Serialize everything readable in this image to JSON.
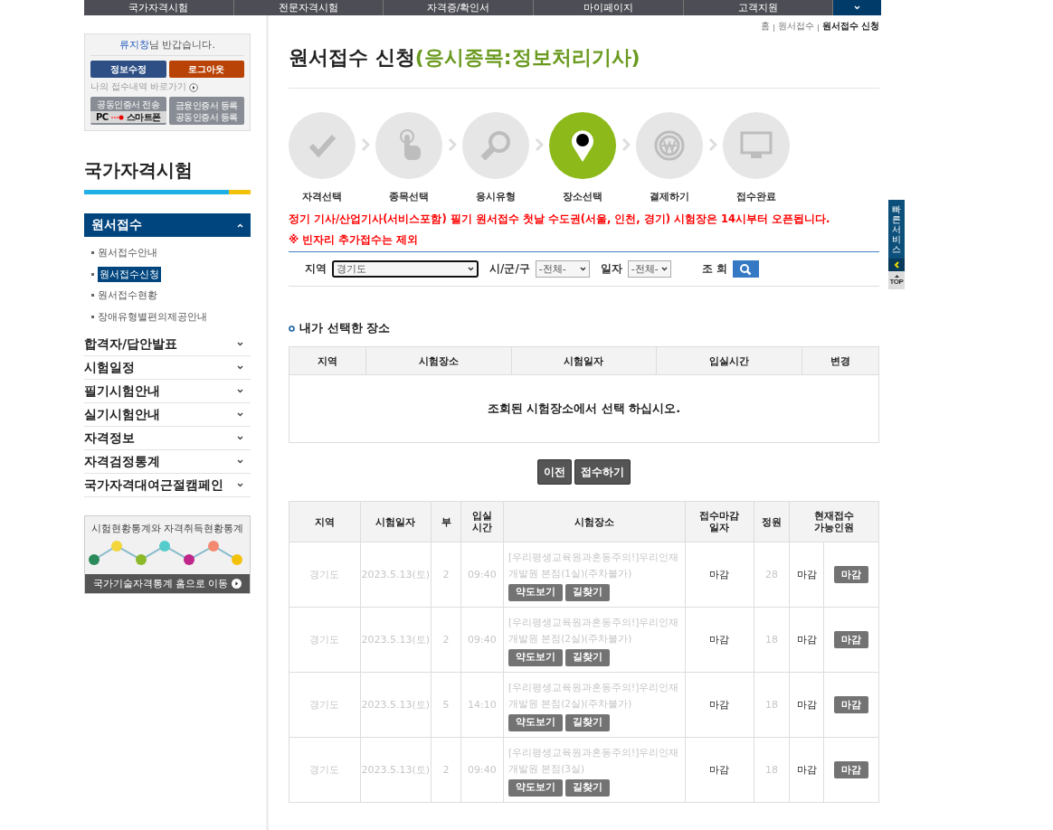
{
  "top_nav": {
    "items": [
      "국가자격시험",
      "전문자격시험",
      "자격증/확인서",
      "마이페이지",
      "고객지원"
    ]
  },
  "user_box": {
    "name": "류지창",
    "greeting": "님 반갑습니다.",
    "buttons": [
      {
        "label": "정보수정",
        "kind": "info"
      },
      {
        "label": "로그아웃",
        "kind": "logout"
      }
    ],
    "history_link": "나의 접수내역 바로가기",
    "cert_send": {
      "title": "공동인증서 전송",
      "from": "PC",
      "to": "스마트폰"
    },
    "cert_register": [
      "금융인증서 등록",
      "공동인증서 등록"
    ]
  },
  "sidebar": {
    "title": "국가자격시험",
    "items": [
      {
        "label": "원서접수",
        "expanded": true,
        "children": [
          {
            "label": "원서접수안내",
            "selected": false
          },
          {
            "label": "원서접수신청",
            "selected": true
          },
          {
            "label": "원서접수현황",
            "selected": false
          },
          {
            "label": "장애유형별편의제공안내",
            "selected": false
          }
        ]
      },
      {
        "label": "합격자/답안발표",
        "expanded": false
      },
      {
        "label": "시험일정",
        "expanded": false
      },
      {
        "label": "필기시험안내",
        "expanded": false
      },
      {
        "label": "실기시험안내",
        "expanded": false
      },
      {
        "label": "자격정보",
        "expanded": false
      },
      {
        "label": "자격검정통계",
        "expanded": false
      },
      {
        "label": "국가자격대여근절캠페인",
        "expanded": false
      }
    ],
    "stats_banner": {
      "title": "시험현황통계와 자격취득현황통계",
      "link": "국가기술자격통계 홈으로 이동"
    }
  },
  "breadcrumb": [
    "홈",
    "원서접수",
    "원서접수 신청"
  ],
  "page_title": {
    "main": "원서접수 신청",
    "sub": "(응시종목:정보처리기사)"
  },
  "steps": [
    {
      "label": "자격선택",
      "kind": "check",
      "selected": false
    },
    {
      "label": "종목선택",
      "kind": "hand",
      "selected": false
    },
    {
      "label": "응시유형",
      "kind": "search",
      "selected": false
    },
    {
      "label": "장소선택",
      "kind": "pin",
      "selected": true
    },
    {
      "label": "결제하기",
      "kind": "coin",
      "selected": false
    },
    {
      "label": "접수완료",
      "kind": "ok",
      "selected": false
    }
  ],
  "notices": [
    "정기 기사/산업기사(서비스포함) 필기 원서접수 첫날 수도권(서울, 인천, 경기) 시험장은 14시부터 오픈됩니다.",
    "※ 빈자리 추가접수는 제외"
  ],
  "search": {
    "fields": [
      {
        "label": "지역",
        "value": "경기도",
        "kind": "wide"
      },
      {
        "label": "시/군/구",
        "value": "-전체-",
        "kind": "mid"
      },
      {
        "label": "일자",
        "value": "-전체-",
        "kind": "small"
      }
    ],
    "button_label": "조 회"
  },
  "selected_places": {
    "title": "내가 선택한 장소",
    "columns": [
      "지역",
      "시험장소",
      "시험일자",
      "입실시간",
      "변경"
    ],
    "empty_message": "조회된 시험장소에서 선택 하십시오."
  },
  "actions": [
    "이전",
    "접수하기"
  ],
  "results": {
    "columns": [
      "지역",
      "시험일자",
      "부",
      "입실\n시간",
      "시험장소",
      "접수마감\n일자",
      "정원",
      "현재접수\n가능인원"
    ],
    "rows": [
      {
        "region": "경기도",
        "date": "2023.5.13(토)",
        "session": "2",
        "time": "09:40",
        "place": "[우리평생교육원과혼동주의!]우리인재개발원 본점(1실)(주차불가)",
        "map_button": "약도보기",
        "route_button": "길찾기",
        "deadline": "마감",
        "capacity": "28",
        "available": "마감",
        "status": "마감"
      },
      {
        "region": "경기도",
        "date": "2023.5.13(토)",
        "session": "2",
        "time": "09:40",
        "place": "[우리평생교육원과혼동주의!]우리인재개발원 본점(2실)(주차불가)",
        "map_button": "약도보기",
        "route_button": "길찾기",
        "deadline": "마감",
        "capacity": "18",
        "available": "마감",
        "status": "마감"
      },
      {
        "region": "경기도",
        "date": "2023.5.13(토)",
        "session": "5",
        "time": "14:10",
        "place": "[우리평생교육원과혼동주의!]우리인재개발원 본점(2실)(주차불가)",
        "map_button": "약도보기",
        "route_button": "길찾기",
        "deadline": "마감",
        "capacity": "18",
        "available": "마감",
        "status": "마감"
      },
      {
        "region": "경기도",
        "date": "2023.5.13(토)",
        "session": "2",
        "time": "09:40",
        "place": "[우리평생교육원과혼동주의!]우리인재개발원 본점(3실)",
        "map_button": "약도보기",
        "route_button": "길찾기",
        "deadline": "마감",
        "capacity": "18",
        "available": "마감",
        "status": "마감"
      }
    ]
  },
  "quick_service": {
    "label": "빠른서비스",
    "top": "TOP"
  }
}
